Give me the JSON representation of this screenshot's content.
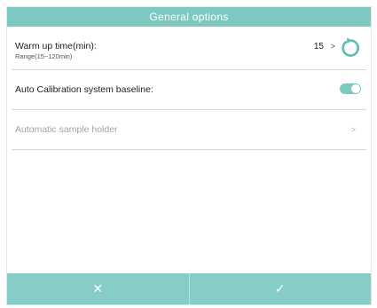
{
  "dialog": {
    "title": "General options"
  },
  "warm_up": {
    "label": "Warm up time(min):",
    "range": "Range(15~120min)",
    "value": "15",
    "chevron": ">",
    "reset_icon": "refresh-icon"
  },
  "auto_calibration": {
    "label": "Auto Calibration system baseline:",
    "toggle_on": true
  },
  "sample_holder": {
    "label": "Automatic sample holder",
    "chevron": ">"
  },
  "footer": {
    "cancel_glyph": "✕",
    "confirm_glyph": "✓"
  },
  "colors": {
    "accent": "#7ec8c2",
    "disabled_text": "#a4a4a4"
  }
}
